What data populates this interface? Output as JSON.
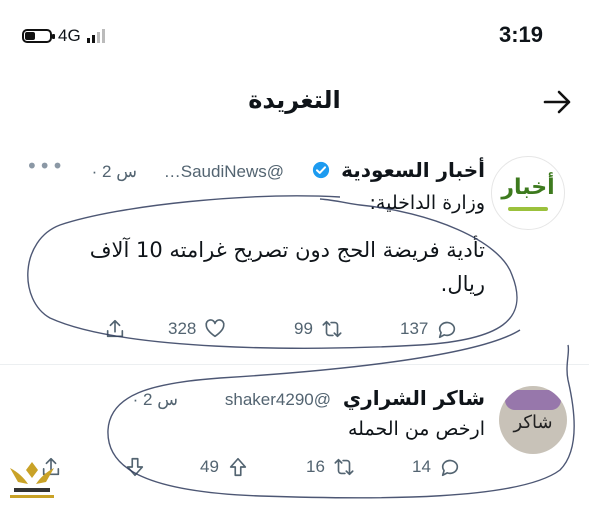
{
  "status_bar": {
    "time": "3:19",
    "network": "4G"
  },
  "header": {
    "title": "التغريدة"
  },
  "tweet1": {
    "name": "أخبار السعودية",
    "handle": "…SaudiNews@",
    "time": "· 2 س",
    "avatar_text": "أخبار",
    "line1": "وزارة الداخلية:",
    "line2": "تأدية فريضة الحج دون تصريح غرامته 10 آلاف",
    "line3": "ريال.",
    "replies": "137",
    "retweets": "99",
    "likes": "328"
  },
  "tweet2": {
    "name": "شاكر الشراري",
    "handle": "shaker4290@",
    "time": "· 2 س",
    "text": "ارخص من الحمله",
    "avatar_text": "شاكر",
    "replies": "14",
    "retweets": "16",
    "likes": "49"
  },
  "colors": {
    "accent": "#1d9bf0",
    "avatar_green": "#3d7a1e",
    "muted": "#536471"
  }
}
